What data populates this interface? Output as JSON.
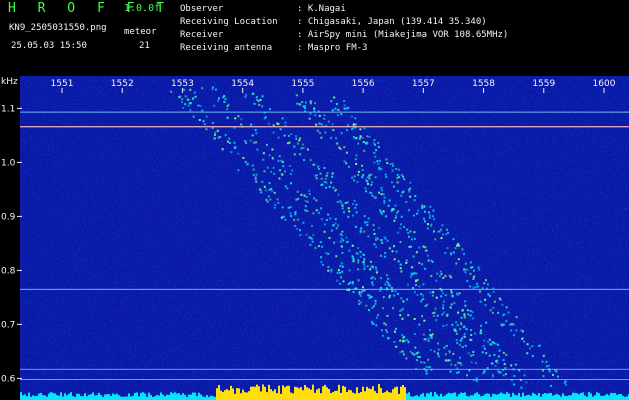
{
  "header": {
    "logo": "H R O F F T",
    "version": "1.0.0f",
    "filename": "KN9_2505031550.png",
    "datetime": "25.05.03 15:50",
    "meteor_label": "meteor",
    "meteor_count": "21",
    "info": [
      {
        "key": "Observer",
        "sep": ":",
        "value": "K.Nagai"
      },
      {
        "key": "Receiving Location",
        "sep": ":",
        "value": "Chigasaki, Japan (139.414 35.340)"
      },
      {
        "key": "Receiver",
        "sep": ":",
        "value": "AirSpy mini (Miakejima VOR 108.65MHz)"
      },
      {
        "key": "Receiving antenna",
        "sep": ":",
        "value": "Maspro FM-3"
      }
    ]
  },
  "chart_data": {
    "type": "heatmap",
    "ylabel": "kHz",
    "x_ticks": [
      "1551",
      "1552",
      "1553",
      "1554",
      "1555",
      "1556",
      "1557",
      "1558",
      "1559",
      "1600"
    ],
    "y_ticks": [
      "1.1",
      "1.0",
      "0.9",
      "0.8",
      "0.7",
      "0.6"
    ],
    "y_tick_values": [
      1.1,
      1.0,
      0.9,
      0.8,
      0.7,
      0.6
    ],
    "ylim": [
      0.56,
      1.16
    ],
    "colors": {
      "background": "#0a1aa8",
      "noise": "#1e3cff",
      "signal": "#00e0ff",
      "carrier": "#ff6060",
      "baseline": "#ffe000",
      "baseline_low": "#00e8ff"
    }
  }
}
